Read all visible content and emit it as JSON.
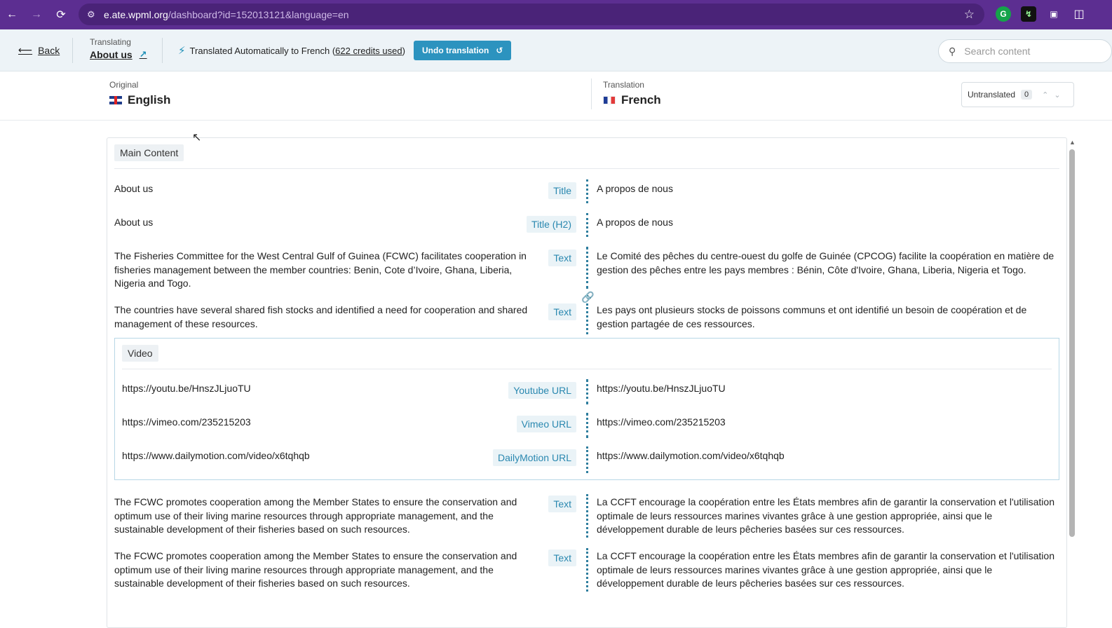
{
  "browser": {
    "url_host": "e.ate.wpml.org",
    "url_path": "/dashboard?id=152013121&language=en"
  },
  "header": {
    "back_label": "Back",
    "translating_label": "Translating",
    "page_name": "About us",
    "auto_prefix": "Translated Automatically to French (",
    "credits": "622 credits used",
    "auto_suffix": ")",
    "undo_label": "Undo translation",
    "search_placeholder": "Search content"
  },
  "languages": {
    "original_label": "Original",
    "original_name": "English",
    "translation_label": "Translation",
    "translation_name": "French",
    "untranslated_label": "Untranslated",
    "untranslated_count": "0"
  },
  "main": {
    "section_label": "Main Content",
    "rows": [
      {
        "source": "About us",
        "field": "Title",
        "target": "A propos de nous"
      },
      {
        "source": "About us",
        "field": "Title (H2)",
        "target": "A propos de nous"
      },
      {
        "source": "The Fisheries Committee for the West Central Gulf of Guinea (FCWC) facilitates cooperation in fisheries management between the member countries: Benin, Cote d’Ivoire, Ghana, Liberia, Nigeria and Togo.",
        "field": "Text",
        "target": "Le Comité des pêches du centre-ouest du golfe de Guinée (CPCOG) facilite la coopération en matière de gestion des pêches entre les pays membres : Bénin, Côte d'Ivoire, Ghana, Liberia, Nigeria et Togo."
      },
      {
        "source": "The countries have several shared fish stocks and identified a need for cooperation and shared management of these resources.",
        "field": "Text",
        "target": "Les pays ont plusieurs stocks de poissons communs et ont identifié un besoin de coopération et de gestion partagée de ces ressources."
      }
    ],
    "video": {
      "section_label": "Video",
      "rows": [
        {
          "source": "https://youtu.be/HnszJLjuoTU",
          "field": "Youtube URL",
          "target": "https://youtu.be/HnszJLjuoTU"
        },
        {
          "source": "https://vimeo.com/235215203",
          "field": "Vimeo URL",
          "target": "https://vimeo.com/235215203"
        },
        {
          "source": "https://www.dailymotion.com/video/x6tqhqb",
          "field": "DailyMotion URL",
          "target": "https://www.dailymotion.com/video/x6tqhqb"
        }
      ]
    },
    "rows_after": [
      {
        "source": "The FCWC promotes cooperation among the Member States to ensure the conservation and optimum use of their living marine resources through appropriate management, and the sustainable development of their fisheries based on such resources.",
        "field": "Text",
        "target": "La CCFT encourage la coopération entre les États membres afin de garantir la conservation et l'utilisation optimale de leurs ressources marines vivantes grâce à une gestion appropriée, ainsi que le développement durable de leurs pêcheries basées sur ces ressources."
      },
      {
        "source": "The FCWC promotes cooperation among the Member States to ensure the conservation and optimum use of their living marine resources through appropriate management, and the sustainable development of their fisheries based on such resources.",
        "field": "Text",
        "target": "La CCFT encourage la coopération entre les États membres afin de garantir la conservation et l'utilisation optimale de leurs ressources marines vivantes grâce à une gestion appropriée, ainsi que le développement durable de leurs pêcheries basées sur ces ressources."
      }
    ]
  },
  "colors": {
    "browser_bar": "#5c2e91",
    "accent": "#2c93bf",
    "field_tag_text": "#2a88b0"
  }
}
